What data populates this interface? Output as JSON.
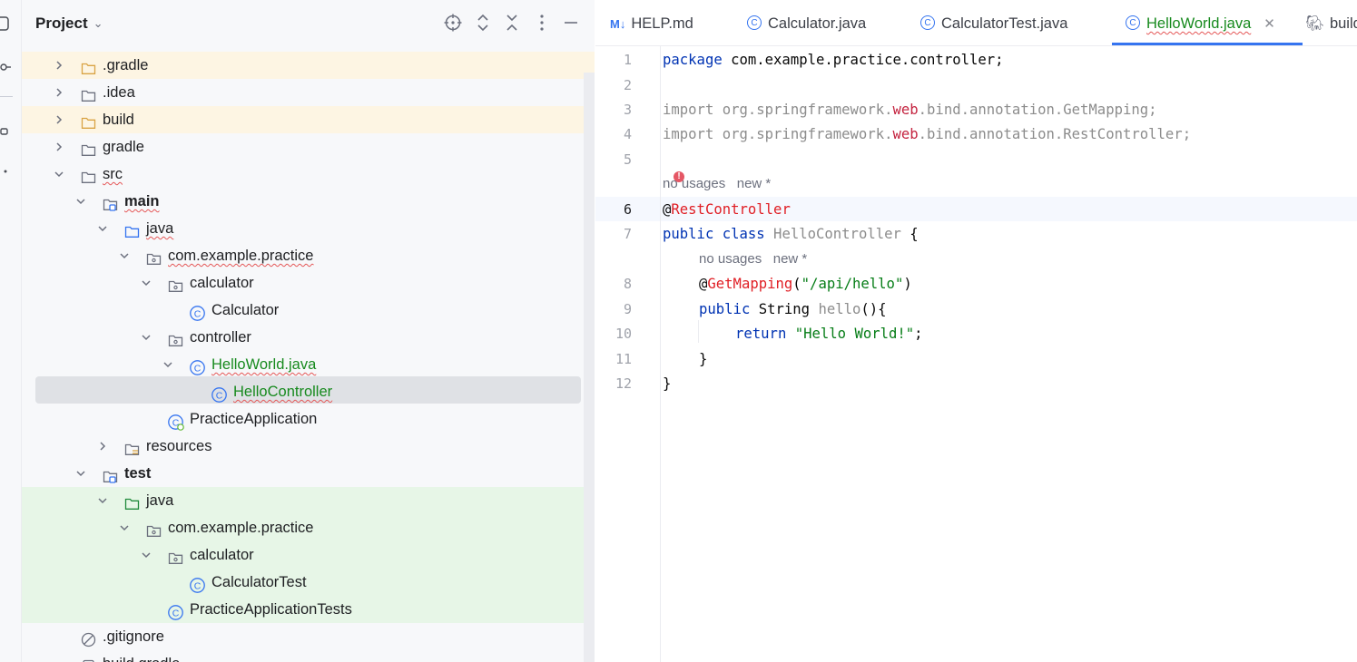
{
  "project": {
    "title": "Project",
    "header_icons": [
      "locate-icon",
      "expand-all-icon",
      "collapse-all-icon",
      "more-vertical-icon",
      "minimize-icon"
    ],
    "tree": [
      {
        "label": ".gradle",
        "icon": "folder-icon",
        "expanded": false,
        "highlight": "yellow"
      },
      {
        "label": ".idea",
        "icon": "folder-icon",
        "expanded": false
      },
      {
        "label": "build",
        "icon": "folder-icon",
        "expanded": false,
        "highlight": "yellow"
      },
      {
        "label": "gradle",
        "icon": "folder-icon",
        "expanded": false
      },
      {
        "label": "src",
        "icon": "folder-icon",
        "expanded": true
      },
      {
        "label": "main",
        "icon": "module-folder-icon",
        "expanded": true
      },
      {
        "label": "java",
        "icon": "source-folder-icon",
        "expanded": true
      },
      {
        "label": "com.example.practice",
        "icon": "package-icon",
        "expanded": true
      },
      {
        "label": "calculator",
        "icon": "package-icon",
        "expanded": true
      },
      {
        "label": "Calculator",
        "icon": "class-icon"
      },
      {
        "label": "controller",
        "icon": "package-icon",
        "expanded": true
      },
      {
        "label": "HelloWorld.java",
        "icon": "class-icon",
        "expanded": true
      },
      {
        "label": "HelloController",
        "icon": "class-icon",
        "selected": true
      },
      {
        "label": "PracticeApplication",
        "icon": "spring-class-icon"
      },
      {
        "label": "resources",
        "icon": "resources-folder-icon",
        "expanded": false
      },
      {
        "label": "test",
        "icon": "module-folder-icon",
        "expanded": true
      },
      {
        "label": "java",
        "icon": "test-folder-icon",
        "expanded": true,
        "highlight": "green"
      },
      {
        "label": "com.example.practice",
        "icon": "package-icon",
        "expanded": true,
        "highlight": "green"
      },
      {
        "label": "calculator",
        "icon": "package-icon",
        "expanded": true,
        "highlight": "green"
      },
      {
        "label": "CalculatorTest",
        "icon": "class-icon",
        "highlight": "green"
      },
      {
        "label": "PracticeApplicationTests",
        "icon": "class-icon",
        "highlight": "green"
      },
      {
        "label": ".gitignore",
        "icon": "ignore-file-icon"
      },
      {
        "label": "build.gradle",
        "icon": "gradle-file-icon"
      }
    ]
  },
  "tabs": [
    {
      "label": "HELP.md",
      "icon": "markdown-icon"
    },
    {
      "label": "Calculator.java",
      "icon": "class-icon"
    },
    {
      "label": "CalculatorTest.java",
      "icon": "class-icon"
    },
    {
      "label": "HelloWorld.java",
      "icon": "class-icon",
      "active": true
    },
    {
      "label": "build",
      "icon": "gradle-elephant-icon"
    }
  ],
  "editor": {
    "line_numbers": [
      "1",
      "2",
      "3",
      "4",
      "5",
      "6",
      "7",
      "8",
      "9",
      "10",
      "11",
      "12"
    ],
    "current_line": "6",
    "code": {
      "l1_kw": "package",
      "l1_rest": " com.example.practice.controller;",
      "l3_a": "import org.springframework.",
      "l3_web": "web",
      "l3_b": ".bind.annotation.GetMapping;",
      "l4_a": "import org.springframework.",
      "l4_web": "web",
      "l4_b": ".bind.annotation.RestController;",
      "l6_at": "@",
      "l6_ann": "RestController",
      "l7_kw": "public class",
      "l7_name": " HelloController ",
      "l7_brace": "{",
      "l8_at": "@",
      "l8_ann": "GetMapping",
      "l8_open": "(",
      "l8_str": "\"/api/hello\"",
      "l8_close": ")",
      "l9_kw": "public",
      "l9_type": " String ",
      "l9_meth": "hello",
      "l9_rest": "(){",
      "l10_kw": "return",
      "l10_str": " \"Hello World!\"",
      "l10_end": ";",
      "l11": "}",
      "l12": "}"
    },
    "hint_class": "no usages   new *",
    "hint_method": "no usages   new *"
  }
}
